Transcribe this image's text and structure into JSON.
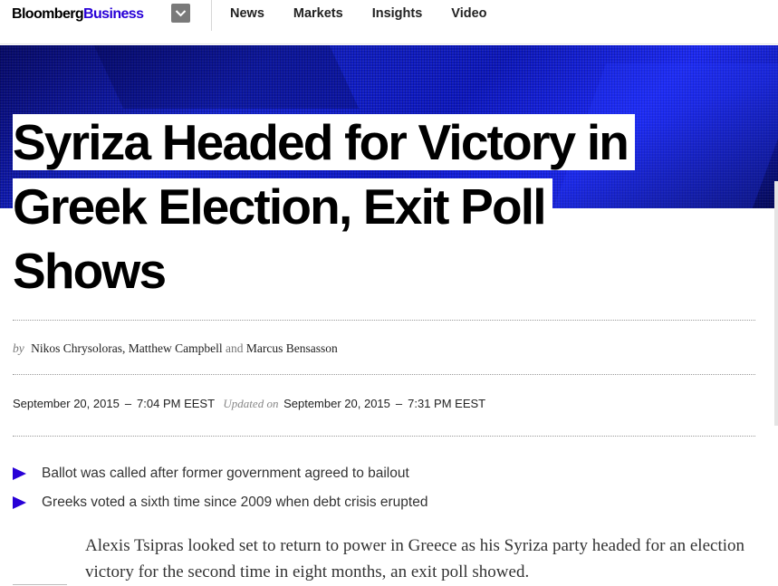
{
  "header": {
    "logo_part1": "Bloomberg",
    "logo_part2": "Business",
    "menu_icon": "chevron-down-icon",
    "nav": [
      "News",
      "Markets",
      "Insights",
      "Video"
    ]
  },
  "colors": {
    "brand_accent": "#2800d7",
    "hero_blue": "#1323d8"
  },
  "article": {
    "headline_line1": "Syriza Headed for Victory in",
    "headline_line2": "Greek Election, Exit Poll",
    "headline_line3": "Shows",
    "byline_by": "by",
    "authors_1": "Nikos Chrysoloras, Matthew Campbell",
    "byline_and": "and",
    "authors_2": "Marcus Bensasson",
    "published_date": "September 20, 2015",
    "published_time": "7:04 PM EEST",
    "updated_label": "Updated on",
    "updated_date": "September 20, 2015",
    "updated_time": "7:31 PM EEST",
    "date_separator": "–",
    "bullets": [
      "Ballot was called after former government agreed to bailout",
      "Greeks voted a sixth time since 2009 when debt crisis erupted"
    ],
    "body": "Alexis Tsipras looked set to return to power in Greece as his Syriza party headed for an election victory for the second time in eight months, an exit poll showed."
  }
}
